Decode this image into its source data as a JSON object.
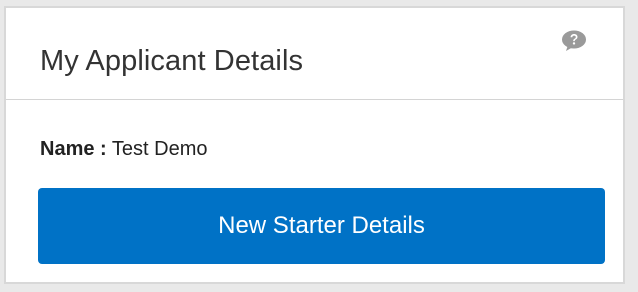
{
  "panel": {
    "title": "My Applicant Details",
    "help_icon": "question-speech-bubble-icon",
    "help_icon_color": "#9a9a9a"
  },
  "applicant": {
    "name_label": "Name :",
    "name_value": "Test Demo"
  },
  "actions": {
    "new_starter_label": "New Starter Details",
    "button_color": "#0072c6"
  }
}
